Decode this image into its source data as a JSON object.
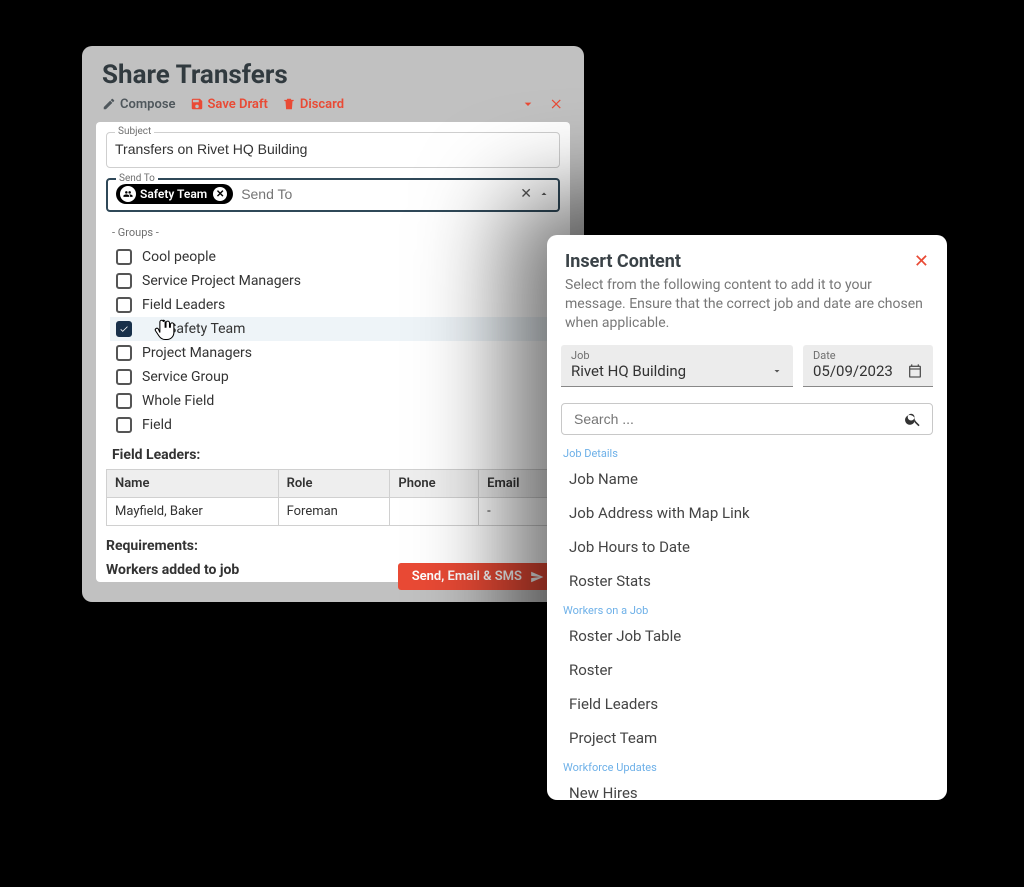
{
  "share": {
    "title": "Share Transfers",
    "toolbar": {
      "compose": "Compose",
      "save_draft": "Save Draft",
      "discard": "Discard"
    },
    "subject": {
      "label": "Subject",
      "value": "Transfers on Rivet HQ Building"
    },
    "send_to": {
      "label": "Send To",
      "placeholder": "Send To",
      "chip": {
        "label": "Safety Team"
      }
    },
    "groups_header": "- Groups -",
    "groups": [
      {
        "label": "Cool people",
        "checked": false
      },
      {
        "label": "Service Project Managers",
        "checked": false
      },
      {
        "label": "Field Leaders",
        "checked": false
      },
      {
        "label": "Safety Team",
        "checked": true
      },
      {
        "label": "Project Managers",
        "checked": false
      },
      {
        "label": "Service Group",
        "checked": false
      },
      {
        "label": "Whole Field",
        "checked": false
      },
      {
        "label": "Field",
        "checked": false
      }
    ],
    "section_cut": "Field Leaders:",
    "leaders": {
      "headers": {
        "name": "Name",
        "role": "Role",
        "phone": "Phone",
        "email": "Email"
      },
      "rows": [
        {
          "name": "Mayfield, Baker",
          "role": "Foreman",
          "phone": "",
          "email": "-"
        }
      ]
    },
    "requirements_label": "Requirements:",
    "workers_added_label": "Workers added to job",
    "send_button": "Send, Email & SMS"
  },
  "insert": {
    "title": "Insert Content",
    "subtitle": "Select from the following content to add it to your message. Ensure that the correct job and date are chosen when applicable.",
    "job": {
      "label": "Job",
      "value": "Rivet HQ Building"
    },
    "date": {
      "label": "Date",
      "value": "05/09/2023"
    },
    "search_placeholder": "Search ...",
    "categories": [
      {
        "label": "Job Details",
        "items": [
          "Job Name",
          "Job Address with Map Link",
          "Job Hours to Date",
          "Roster Stats"
        ]
      },
      {
        "label": "Workers on a Job",
        "items": [
          "Roster Job Table",
          "Roster",
          "Field Leaders",
          "Project Team"
        ]
      },
      {
        "label": "Workforce Updates",
        "items": [
          "New Hires"
        ]
      }
    ]
  },
  "colors": {
    "accent": "#e94a35"
  }
}
